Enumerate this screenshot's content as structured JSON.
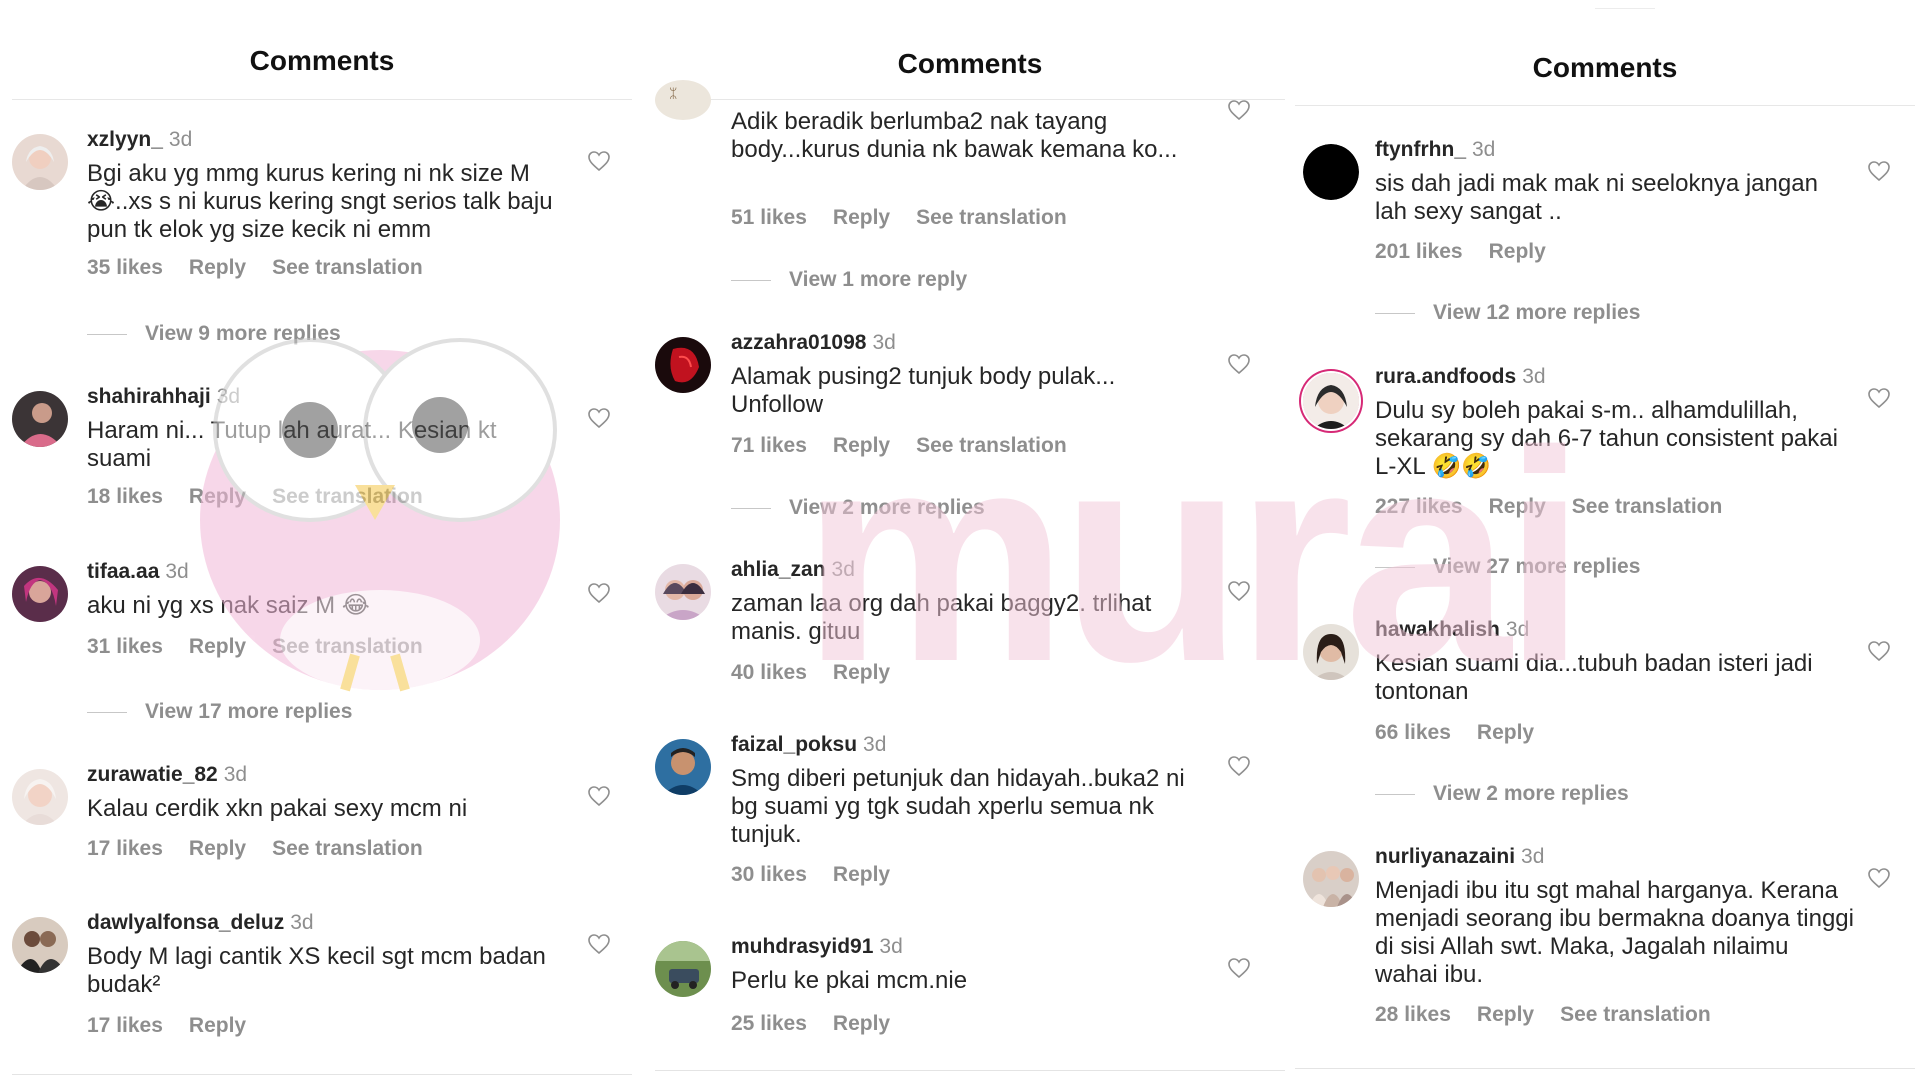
{
  "panels": [
    {
      "title": "Comments",
      "comments": [
        {
          "username": "xzlyyn_",
          "time": "3d",
          "text": "Bgi aku yg mmg kurus kering ni nk size M 😭..xs s ni kurus kering sngt serios talk baju pun tk elok yg size kecik ni emm",
          "likes": "35 likes",
          "reply": "Reply",
          "translation": "See translation",
          "view_replies": "View 9 more replies"
        },
        {
          "username": "shahirahhaji",
          "time": "3d",
          "text": "Haram ni... Tutup lah aurat... Kesian kt suami",
          "likes": "18 likes",
          "reply": "Reply",
          "translation": "See translation"
        },
        {
          "username": "tifaa.aa",
          "time": "3d",
          "text": "aku ni yg xs nak saiz M 😂",
          "likes": "31 likes",
          "reply": "Reply",
          "translation": "See translation",
          "view_replies": "View 17 more replies"
        },
        {
          "username": "zurawatie_82",
          "time": "3d",
          "text": "Kalau cerdik xkn pakai sexy mcm ni",
          "likes": "17 likes",
          "reply": "Reply",
          "translation": "See translation"
        },
        {
          "username": "dawlyalfonsa_deluz",
          "time": "3d",
          "text": "Body M lagi cantik XS kecil sgt mcm badan budak²",
          "likes": "17 likes",
          "reply": "Reply"
        }
      ]
    },
    {
      "title": "Comments",
      "comments": [
        {
          "username": "",
          "time": "",
          "text": "Adik beradik berlumba2 nak tayang body...kurus dunia nk bawak kemana ko...",
          "likes": "51 likes",
          "reply": "Reply",
          "translation": "See translation",
          "view_replies": "View 1 more reply"
        },
        {
          "username": "azzahra01098",
          "time": "3d",
          "text": "Alamak pusing2 tunjuk body pulak... Unfollow",
          "likes": "71 likes",
          "reply": "Reply",
          "translation": "See translation",
          "view_replies": "View 2 more replies"
        },
        {
          "username": "ahlia_zan",
          "time": "3d",
          "text": "zaman laa org dah pakai baggy2. trlihat manis. gituu",
          "likes": "40 likes",
          "reply": "Reply"
        },
        {
          "username": "faizal_poksu",
          "time": "3d",
          "text": "Smg diberi petunjuk dan hidayah..buka2 ni bg suami yg tgk sudah xperlu semua nk tunjuk.",
          "likes": "30 likes",
          "reply": "Reply"
        },
        {
          "username": "muhdrasyid91",
          "time": "3d",
          "text": "Perlu ke pkai mcm.nie",
          "likes": "25 likes",
          "reply": "Reply"
        }
      ]
    },
    {
      "title": "Comments",
      "comments": [
        {
          "username": "ftynfrhn_",
          "time": "3d",
          "text": "sis dah jadi mak mak ni seeloknya jangan lah sexy sangat ..",
          "likes": "201 likes",
          "reply": "Reply",
          "view_replies": "View 12 more replies"
        },
        {
          "username": "rura.andfoods",
          "time": "3d",
          "text": "Dulu sy boleh pakai s-m.. alhamdulillah, sekarang sy dah 6-7 tahun consistent pakai L-XL 🤣🤣",
          "likes": "227 likes",
          "reply": "Reply",
          "translation": "See translation",
          "view_replies": "View 27 more replies"
        },
        {
          "username": "hawakhalish",
          "time": "3d",
          "text": "Kesian suami dia...tubuh badan isteri jadi tontonan",
          "likes": "66 likes",
          "reply": "Reply",
          "view_replies": "View 2 more replies"
        },
        {
          "username": "nurliyanazaini",
          "time": "3d",
          "text": "Menjadi ibu itu sgt mahal harganya. Kerana menjadi seorang ibu bermakna doanya tinggi di sisi Allah swt. Maka, Jagalah nilaimu wahai ibu.",
          "likes": "28 likes",
          "reply": "Reply",
          "translation": "See translation"
        }
      ]
    }
  ],
  "watermark": {
    "text": "murai"
  },
  "colors": {
    "text": "#262626",
    "muted": "#8e8e8e",
    "divider": "#e7e7e7",
    "watermark": "#f3c6d8"
  }
}
